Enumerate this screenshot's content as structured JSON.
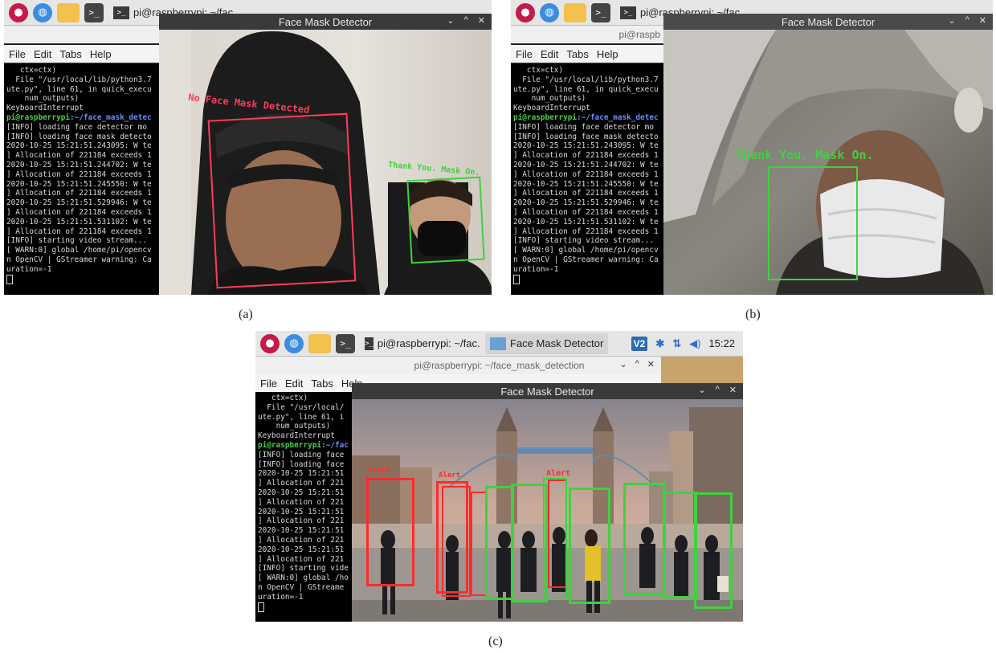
{
  "captions": {
    "a": "(a)",
    "b": "(b)",
    "c": "(c)"
  },
  "taskbar": {
    "terminal_task_label": "pi@raspberrypi: ~/fac...",
    "window_task_label": "Face Mask Detector",
    "time": "15:22",
    "vnc_label": "V2"
  },
  "terminal": {
    "title": "pi@raspberrypi: ~/face_mask_detection",
    "title_short": "pi@raspb",
    "menu": [
      "File",
      "Edit",
      "Tabs",
      "Help"
    ],
    "prompt_user": "pi@raspberrypi",
    "prompt_path": ":~/face_mask_detec"
  },
  "terminal_lines_a": [
    "   ctx=ctx)",
    "  File \"/usr/local/lib/python3.7",
    "ute.py\", line 61, in quick_execu",
    "    num_outputs)",
    "KeyboardInterrupt",
    "__PROMPT__",
    "[INFO] loading face detector mo",
    "[INFO] loading face mask detecto",
    "2020-10-25 15:21:51.243095: W te",
    "] Allocation of 221184 exceeds 1",
    "2020-10-25 15:21:51.244702: W te",
    "] Allocation of 221184 exceeds 1",
    "2020-10-25 15:21:51.245550: W te",
    "] Allocation of 221184 exceeds 1",
    "2020-10-25 15:21:51.529946: W te",
    "] Allocation of 221184 exceeds 1",
    "2020-10-25 15:21:51.531102: W te",
    "] Allocation of 221184 exceeds 1",
    "[INFO] starting video stream...",
    "[ WARN:0] global /home/pi/opencv",
    "n OpenCV | GStreamer warning: Ca",
    "uration=-1"
  ],
  "terminal_lines_c": [
    "   ctx=ctx)",
    "  File \"/usr/local/",
    "ute.py\", line 61, i",
    "    num_outputs)",
    "KeyboardInterrupt",
    "__PROMPT_C__",
    "[INFO] loading face",
    "[INFO] loading face",
    "2020-10-25 15:21:51",
    "] Allocation of 221",
    "2020-10-25 15:21:51",
    "] Allocation of 221",
    "2020-10-25 15:21:51",
    "] Allocation of 221",
    "2020-10-25 15:21:51",
    "] Allocation of 221",
    "2020-10-25 15:21:51",
    "] Allocation of 221",
    "[INFO] starting vide",
    "[ WARN:0] global /ho",
    "n OpenCV | GStreame",
    "uration=-1"
  ],
  "prompt_c": {
    "user": "pi@raspberrypi",
    "path": ":~/fac"
  },
  "detector": {
    "window_title": "Face Mask Detector",
    "label_no_mask": "No Face Mask Detected",
    "label_mask": "Thank You. Mask On.",
    "label_alert": "Alert",
    "colors": {
      "no_mask": "#ff3b5c",
      "mask": "#3fd13f",
      "alert": "#ff2b2b"
    }
  }
}
